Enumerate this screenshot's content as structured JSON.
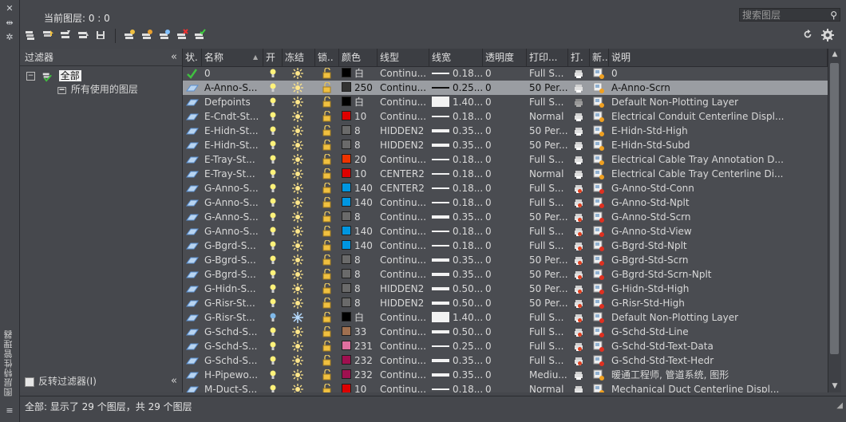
{
  "palette": {
    "title": "图层特性管理器"
  },
  "header": {
    "current_layer": "当前图层: 0 : 0",
    "search_placeholder": "搜索图层"
  },
  "filters": {
    "title": "过滤器",
    "tree": {
      "root": "全部",
      "child": "所有使用的图层"
    },
    "invert_label": "反转过滤器(I)"
  },
  "columns": [
    "状.",
    "名称",
    "开",
    "冻结",
    "锁..",
    "颜色",
    "线型",
    "线宽",
    "透明度",
    "打印...",
    "打.",
    "新..",
    "说明"
  ],
  "layers": [
    {
      "name": "0",
      "color_val": "白",
      "color_hex": "#000000",
      "linetype": "Continu...",
      "lw": "0.18...",
      "lwstyle": "thin",
      "trans": "0",
      "plot": "Full S...",
      "desc": "0",
      "current": true,
      "frozen": false,
      "noplot": false,
      "newvp": false,
      "sel": false
    },
    {
      "name": "A-Anno-S...",
      "color_val": "250",
      "color_hex": "#333333",
      "linetype": "Continu...",
      "lw": "0.25...",
      "lwstyle": "thin",
      "trans": "0",
      "plot": "50 Per...",
      "desc": "A-Anno-Scrn",
      "current": false,
      "frozen": false,
      "noplot": false,
      "newvp": false,
      "sel": true
    },
    {
      "name": "Defpoints",
      "color_val": "白",
      "color_hex": "#000000",
      "linetype": "Continu...",
      "lw": "1.40...",
      "lwstyle": "box",
      "trans": "0",
      "plot": "Full S...",
      "desc": "Default Non-Plotting Layer",
      "current": false,
      "frozen": false,
      "noplot": true,
      "newvp": false,
      "sel": false
    },
    {
      "name": "E-Cndt-St...",
      "color_val": "10",
      "color_hex": "#dd0000",
      "linetype": "Continu...",
      "lw": "0.18...",
      "lwstyle": "thin",
      "trans": "0",
      "plot": "Normal",
      "desc": "Electrical Conduit Centerline Displ...",
      "current": false,
      "frozen": false,
      "noplot": false,
      "newvp": false,
      "sel": false
    },
    {
      "name": "E-Hidn-St...",
      "color_val": "8",
      "color_hex": "#6a6a6a",
      "linetype": "HIDDEN2",
      "lw": "0.35...",
      "lwstyle": "thick",
      "trans": "0",
      "plot": "50 Per...",
      "desc": "E-Hidn-Std-High",
      "current": false,
      "frozen": false,
      "noplot": false,
      "newvp": false,
      "sel": false
    },
    {
      "name": "E-Hidn-St...",
      "color_val": "8",
      "color_hex": "#6a6a6a",
      "linetype": "HIDDEN2",
      "lw": "0.35...",
      "lwstyle": "thick",
      "trans": "0",
      "plot": "50 Per...",
      "desc": "E-Hidn-Std-Subd",
      "current": false,
      "frozen": false,
      "noplot": false,
      "newvp": false,
      "sel": false
    },
    {
      "name": "E-Tray-St...",
      "color_val": "20",
      "color_hex": "#ee3300",
      "linetype": "Continu...",
      "lw": "0.18...",
      "lwstyle": "thin",
      "trans": "0",
      "plot": "Full S...",
      "desc": "Electrical Cable Tray Annotation D...",
      "current": false,
      "frozen": false,
      "noplot": false,
      "newvp": false,
      "sel": false
    },
    {
      "name": "E-Tray-St...",
      "color_val": "10",
      "color_hex": "#dd0000",
      "linetype": "CENTER2",
      "lw": "0.18...",
      "lwstyle": "thin",
      "trans": "0",
      "plot": "Normal",
      "desc": "Electrical Cable Tray Centerline Di...",
      "current": false,
      "frozen": false,
      "noplot": false,
      "newvp": false,
      "sel": false
    },
    {
      "name": "G-Anno-S...",
      "color_val": "140",
      "color_hex": "#0096e0",
      "linetype": "CENTER2",
      "lw": "0.18...",
      "lwstyle": "thin",
      "trans": "0",
      "plot": "Full S...",
      "desc": "G-Anno-Std-Conn",
      "current": false,
      "frozen": false,
      "noplot": false,
      "newvp": true,
      "sel": false
    },
    {
      "name": "G-Anno-S...",
      "color_val": "140",
      "color_hex": "#0096e0",
      "linetype": "Continu...",
      "lw": "0.18...",
      "lwstyle": "thin",
      "trans": "0",
      "plot": "Full S...",
      "desc": "G-Anno-Std-Nplt",
      "current": false,
      "frozen": false,
      "noplot": false,
      "newvp": true,
      "sel": false
    },
    {
      "name": "G-Anno-S...",
      "color_val": "8",
      "color_hex": "#6a6a6a",
      "linetype": "Continu...",
      "lw": "0.35...",
      "lwstyle": "thick",
      "trans": "0",
      "plot": "50 Per...",
      "desc": "G-Anno-Std-Scrn",
      "current": false,
      "frozen": false,
      "noplot": false,
      "newvp": true,
      "sel": false
    },
    {
      "name": "G-Anno-S...",
      "color_val": "140",
      "color_hex": "#0096e0",
      "linetype": "Continu...",
      "lw": "0.18...",
      "lwstyle": "thin",
      "trans": "0",
      "plot": "Full S...",
      "desc": "G-Anno-Std-View",
      "current": false,
      "frozen": false,
      "noplot": false,
      "newvp": true,
      "sel": false
    },
    {
      "name": "G-Bgrd-S...",
      "color_val": "140",
      "color_hex": "#0096e0",
      "linetype": "Continu...",
      "lw": "0.18...",
      "lwstyle": "thin",
      "trans": "0",
      "plot": "Full S...",
      "desc": "G-Bgrd-Std-Nplt",
      "current": false,
      "frozen": false,
      "noplot": false,
      "newvp": true,
      "sel": false
    },
    {
      "name": "G-Bgrd-S...",
      "color_val": "8",
      "color_hex": "#6a6a6a",
      "linetype": "Continu...",
      "lw": "0.35...",
      "lwstyle": "thick",
      "trans": "0",
      "plot": "50 Per...",
      "desc": "G-Bgrd-Std-Scrn",
      "current": false,
      "frozen": false,
      "noplot": false,
      "newvp": true,
      "sel": false
    },
    {
      "name": "G-Bgrd-S...",
      "color_val": "8",
      "color_hex": "#6a6a6a",
      "linetype": "Continu...",
      "lw": "0.35...",
      "lwstyle": "thick",
      "trans": "0",
      "plot": "50 Per...",
      "desc": "G-Bgrd-Std-Scrn-Nplt",
      "current": false,
      "frozen": false,
      "noplot": false,
      "newvp": true,
      "sel": false
    },
    {
      "name": "G-Hidn-S...",
      "color_val": "8",
      "color_hex": "#6a6a6a",
      "linetype": "HIDDEN2",
      "lw": "0.50...",
      "lwstyle": "thick",
      "trans": "0",
      "plot": "50 Per...",
      "desc": "G-Hidn-Std-High",
      "current": false,
      "frozen": false,
      "noplot": false,
      "newvp": true,
      "sel": false
    },
    {
      "name": "G-Risr-St...",
      "color_val": "8",
      "color_hex": "#6a6a6a",
      "linetype": "HIDDEN2",
      "lw": "0.50...",
      "lwstyle": "thick",
      "trans": "0",
      "plot": "50 Per...",
      "desc": "G-Risr-Std-High",
      "current": false,
      "frozen": false,
      "noplot": false,
      "newvp": true,
      "sel": false
    },
    {
      "name": "G-Risr-St...",
      "color_val": "白",
      "color_hex": "#000000",
      "linetype": "Continu...",
      "lw": "1.40...",
      "lwstyle": "box",
      "trans": "0",
      "plot": "Full S...",
      "desc": "Default Non-Plotting Layer",
      "current": false,
      "frozen": true,
      "noplot": false,
      "newvp": true,
      "sel": false
    },
    {
      "name": "G-Schd-S...",
      "color_val": "33",
      "color_hex": "#a07050",
      "linetype": "Continu...",
      "lw": "0.50...",
      "lwstyle": "thick",
      "trans": "0",
      "plot": "Full S...",
      "desc": "G-Schd-Std-Line",
      "current": false,
      "frozen": false,
      "noplot": false,
      "newvp": true,
      "sel": false
    },
    {
      "name": "G-Schd-S...",
      "color_val": "231",
      "color_hex": "#e070a0",
      "linetype": "Continu...",
      "lw": "0.25...",
      "lwstyle": "thin",
      "trans": "0",
      "plot": "Full S...",
      "desc": "G-Schd-Std-Text-Data",
      "current": false,
      "frozen": false,
      "noplot": false,
      "newvp": true,
      "sel": false
    },
    {
      "name": "G-Schd-S...",
      "color_val": "232",
      "color_hex": "#a01050",
      "linetype": "Continu...",
      "lw": "0.35...",
      "lwstyle": "thick",
      "trans": "0",
      "plot": "Full S...",
      "desc": "G-Schd-Std-Text-Hedr",
      "current": false,
      "frozen": false,
      "noplot": false,
      "newvp": true,
      "sel": false
    },
    {
      "name": "H-Pipewo...",
      "color_val": "232",
      "color_hex": "#a01050",
      "linetype": "Continu...",
      "lw": "0.35...",
      "lwstyle": "thick",
      "trans": "0",
      "plot": "Mediu...",
      "desc": "暖通工程师, 管道系统, 图形",
      "current": false,
      "frozen": false,
      "noplot": false,
      "newvp": false,
      "sel": false
    },
    {
      "name": "M-Duct-S...",
      "color_val": "10",
      "color_hex": "#dd0000",
      "linetype": "Continu...",
      "lw": "0.18...",
      "lwstyle": "thin",
      "trans": "0",
      "plot": "Normal",
      "desc": "Mechanical Duct Centerline Displ...",
      "current": false,
      "frozen": false,
      "noplot": false,
      "newvp": false,
      "sel": false
    }
  ],
  "status": {
    "text": "全部: 显示了 29 个图层，共 29 个图层"
  }
}
